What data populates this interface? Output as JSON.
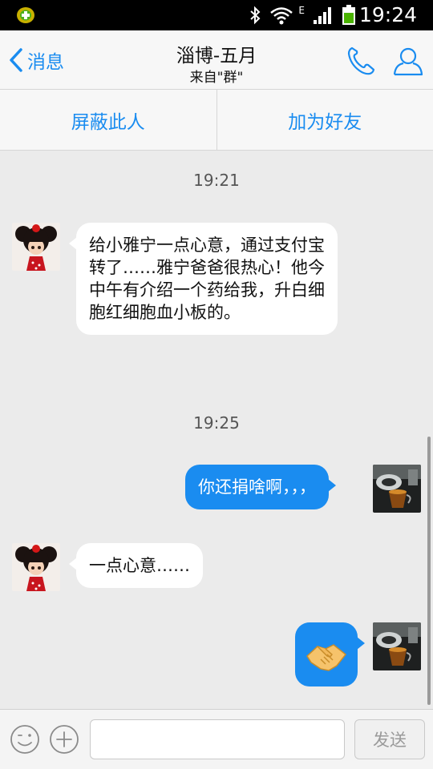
{
  "status_bar": {
    "time": "19:24",
    "network_type": "E",
    "icons": [
      "app-notification-icon",
      "bluetooth-icon",
      "wifi-icon",
      "signal-icon",
      "battery-icon"
    ]
  },
  "nav": {
    "back_label": "消息",
    "title": "淄博-五月",
    "subtitle": "来自\"群\"",
    "icons": [
      "chevron-left-icon",
      "phone-icon",
      "person-icon"
    ]
  },
  "actions": {
    "block_label": "屏蔽此人",
    "add_friend_label": "加为好友"
  },
  "messages": [
    {
      "type": "time",
      "text": "19:21"
    },
    {
      "type": "incoming",
      "avatar": "doll-avatar",
      "text": "给小雅宁一点心意，通过支付宝转了……雅宁爸爸很热心！他今中午有介绍一个药给我，升白细胞红细胞血小板的。"
    },
    {
      "type": "time",
      "text": "19:25"
    },
    {
      "type": "outgoing",
      "avatar": "tea-cup-avatar",
      "text": "你还捐啥啊，，，"
    },
    {
      "type": "incoming",
      "avatar": "doll-avatar",
      "text": "一点心意……"
    },
    {
      "type": "outgoing",
      "avatar": "tea-cup-avatar",
      "emoji": "handshake-icon"
    }
  ],
  "input_bar": {
    "placeholder": "",
    "value": "",
    "send_label": "发送",
    "icons": [
      "emoji-icon",
      "plus-icon"
    ]
  },
  "colors": {
    "accent": "#1a8cf0",
    "chat_background": "#ebebeb",
    "incoming_bubble": "#ffffff",
    "outgoing_bubble": "#1a8cf0"
  }
}
